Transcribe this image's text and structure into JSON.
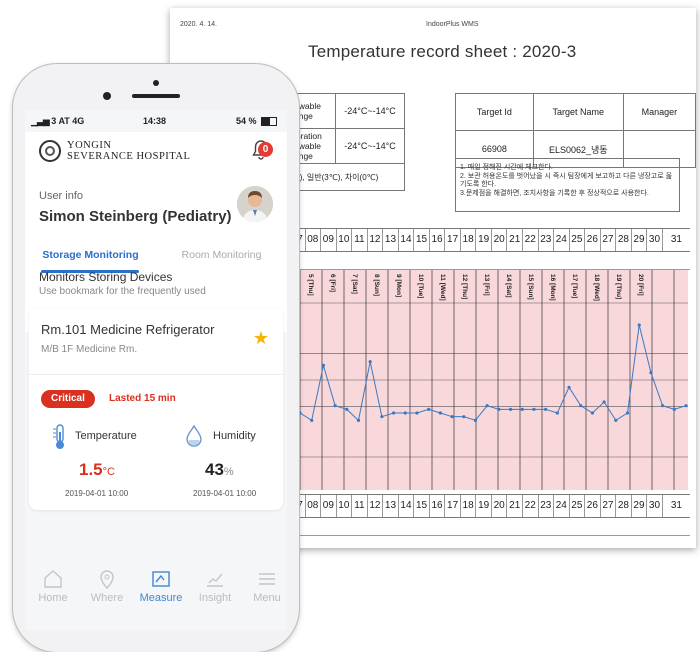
{
  "document": {
    "header_date": "2020. 4. 14.",
    "header_app": "IndoorPlus WMS",
    "title": "Temperature record sheet : 2020-3",
    "left_table": [
      {
        "label": "owable\nange",
        "value": "-24°C~-14°C"
      },
      {
        "label": "ibration\nowable\nange",
        "value": "-24°C~-14°C"
      },
      {
        "label": "",
        "value": "C), 일반(3℃), 차이(0℃)"
      }
    ],
    "right_table": {
      "headers": [
        "Target Id",
        "Target Name",
        "Manager"
      ],
      "values": [
        "66908",
        "ELS0062_냉동",
        ""
      ]
    },
    "notes": [
      "1. 매일 정해진 시간에 체크한다.",
      "2. 보관 허용온도를 벗어났을 시 즉시 팀장에게 보고하고 다른 냉장고로 옮기도록 한다.",
      "3.문제점을 해결하면, 조치사항을 기록한 후 정상적으로 사용한다."
    ],
    "days_top": [
      "07",
      "08",
      "09",
      "10",
      "11",
      "12",
      "13",
      "14",
      "15",
      "16",
      "17",
      "18",
      "19",
      "20",
      "21",
      "22",
      "23",
      "24",
      "25",
      "26",
      "27",
      "28",
      "29",
      "30",
      "31"
    ],
    "days_bottom": [
      "07",
      "08",
      "09",
      "10",
      "11",
      "12",
      "13",
      "14",
      "15",
      "16",
      "17",
      "18",
      "19",
      "20",
      "21",
      "22",
      "23",
      "24",
      "25",
      "26",
      "27",
      "28",
      "29",
      "30",
      "31"
    ],
    "weekday_labels": [
      "5 [Thu]",
      "6 [Fri]",
      "7 [Sat]",
      "8 [Sun]",
      "9 [Mon]",
      "10 [Tue]",
      "11 [Wed]",
      "12 [Thu]",
      "13 [Fri]",
      "14 [Sat]",
      "15 [Sun]",
      "16 [Mon]",
      "17 [Tue]",
      "18 [Wed]",
      "19 [Thu]",
      "20 [Fri]"
    ]
  },
  "chart_data": {
    "type": "line",
    "series": [
      {
        "values": [
          -19.5,
          -20.5,
          -13,
          -18.5,
          -19,
          -20.5,
          -12.5,
          -20,
          -19.5,
          -19.5,
          -19.5,
          -19,
          -19.5,
          -20,
          -20,
          -20.5,
          -18.5,
          -19,
          -19,
          -19,
          -19,
          -19,
          -19.5,
          -16,
          -18.5,
          -19.5,
          -18,
          -20.5,
          -19.5,
          -7.5,
          -14,
          -18.5,
          -19,
          -18.5
        ]
      }
    ],
    "ylim": [
      -30,
      0
    ],
    "color": "#3b78c2"
  },
  "phone": {
    "status": {
      "carrier": "3 AT  4G",
      "time": "14:38",
      "battery": "54 %",
      "battery_level": 0.54
    },
    "logo_line1": "YONGIN",
    "logo_line2": "SEVERANCE HOSPITAL",
    "notification_count": "0",
    "user_info_label": "User info",
    "user_name": "Simon Steinberg (Pediatry)",
    "tabs": [
      "Storage Monitoring",
      "Room Monitoring"
    ],
    "section_title": "Monitors Storing Devices",
    "section_sub": "Use bookmark for the frequently used",
    "card": {
      "title": "Rm.101 Medicine Refrigerator",
      "subtitle": "M/B 1F Medicine Rm.",
      "status": "Critical",
      "lasted": "Lasted 15 min",
      "temperature_label": "Temperature",
      "temperature_value": "1.5",
      "temperature_unit": "°C",
      "temperature_date": "2019-04-01 10:00",
      "humidity_label": "Humidity",
      "humidity_value": "43",
      "humidity_unit": "%",
      "humidity_date": "2019-04-01 10:00",
      "colors": {
        "critical": "#d9301f",
        "star": "#f5b400"
      }
    },
    "nav": [
      "Home",
      "Where",
      "Measure",
      "Insight",
      "Menu"
    ],
    "nav_active": "Measure",
    "accent_color": "#3f86d6"
  }
}
